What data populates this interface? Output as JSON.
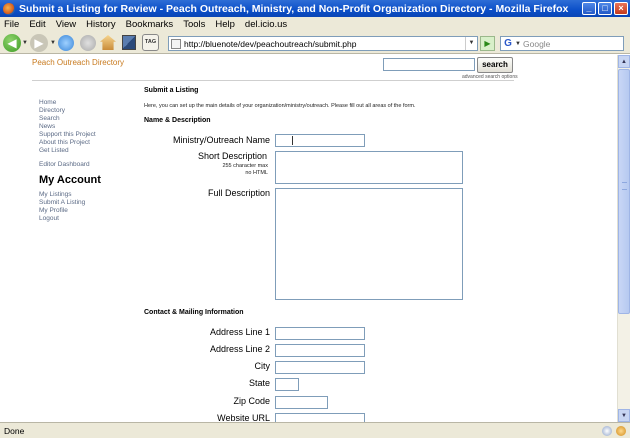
{
  "window": {
    "title": "Submit a Listing for Review - Peach Outreach, Ministry, and Non-Profit Organization Directory - Mozilla Firefox"
  },
  "menu": [
    "File",
    "Edit",
    "View",
    "History",
    "Bookmarks",
    "Tools",
    "Help",
    "del.icio.us"
  ],
  "toolbar": {
    "url": "http://bluenote/dev/peachoutreach/submit.php",
    "search_placeholder": "Google",
    "tag_label": "TAG"
  },
  "header": {
    "site_title": "Peach Outreach Directory",
    "search_button": "search",
    "advanced_link": "advanced search options"
  },
  "sidebar": {
    "links": [
      "Home",
      "Directory",
      "Search",
      "News",
      "Support this Project",
      "About this Project",
      "Get Listed"
    ],
    "editor_link": "Editor Dashboard",
    "account_heading": "My Account",
    "account_links": [
      "My Listings",
      "Submit A Listing",
      "My Profile",
      "Logout"
    ]
  },
  "form": {
    "title": "Submit a Listing",
    "intro": "Here, you can set up the main details of your organization/ministry/outreach.  Please fill out all areas of the form.",
    "section_name": "Name & Description",
    "name_label": "Ministry/Outreach Name",
    "short_desc_label": "Short Description",
    "short_desc_note1": "255 character max",
    "short_desc_note2": "no HTML",
    "full_desc_label": "Full Description",
    "section_contact": "Contact & Mailing Information",
    "address1_label": "Address Line 1",
    "address2_label": "Address Line 2",
    "city_label": "City",
    "state_label": "State",
    "zip_label": "Zip Code",
    "website_label": "Website URL"
  },
  "status": {
    "text": "Done"
  }
}
